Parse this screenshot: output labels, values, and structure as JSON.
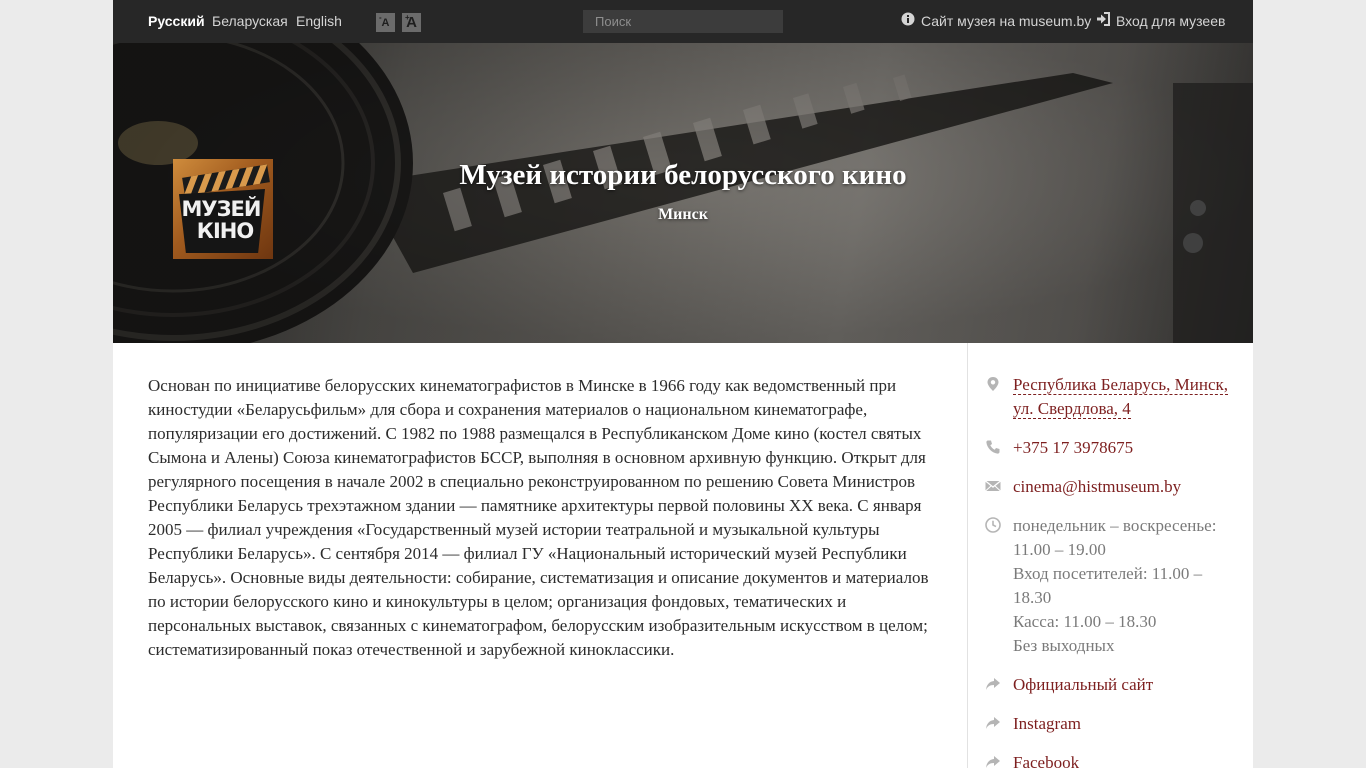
{
  "topbar": {
    "languages": [
      "Русский",
      "Беларуская",
      "English"
    ],
    "active_language": "Русский",
    "font_small_label": "A",
    "font_big_label": "A",
    "font_small_mod": "-",
    "font_big_mod": "+",
    "search_placeholder": "Поиск",
    "site_link": "Сайт музея на museum.by",
    "login_link": "Вход для музеев"
  },
  "hero": {
    "title": "Музей истории белорусского кино",
    "city": "Минск",
    "logo_line1": "МУЗЕЙ",
    "logo_line2": "КIНО"
  },
  "description": "Основан по инициативе белорусских кинематографистов в Минске в 1966 году как ведомственный при киностудии «Беларусьфильм» для сбора и сохранения материалов о национальном кинематографе, популяризации его достижений. С 1982 по 1988 размещался в Республиканском Доме кино (костел святых Сымона и Алены) Союза кинематографистов БССР, выполняя в основном архивную функцию. Открыт для регулярного посещения в начале 2002 в специально реконструированном по решению Совета Министров Республики Беларусь трехэтажном здании — памятнике архитектуры первой половины XX века. С января 2005 — филиал учреждения «Государственный музей истории театральной и музыкальной культуры Республики Беларусь». С сентября 2014 — филиал ГУ «Национальный исторический музей Республики Беларусь». Основные виды деятельности: собирание, систематизация и описание документов и материалов по истории белорусского кино и кинокультуры в целом; организация фондовых, тематических и персональных выставок, связанных с кинематографом, белорусским изобразительным искусством в целом; систематизированный показ отечественной и зарубежной киноклассики.",
  "sidebar": {
    "address_line1": "Республика Беларусь, Минск,",
    "address_line2": "ул. Свердлова, 4",
    "phone": "+375 17 3978675",
    "email": "cinema@histmuseum.by",
    "hours": [
      "понедельник – воскресенье:",
      "11.00 – 19.00",
      "Вход посетителей: 11.00 –",
      "18.30",
      "Касса: 11.00 – 18.30",
      "Без выходных"
    ],
    "links": [
      "Официальный сайт",
      "Instagram",
      "Facebook"
    ]
  },
  "colors": {
    "topbar_bg": "#272727",
    "link": "#7d1f1f",
    "icon": "#b5b5b5"
  }
}
